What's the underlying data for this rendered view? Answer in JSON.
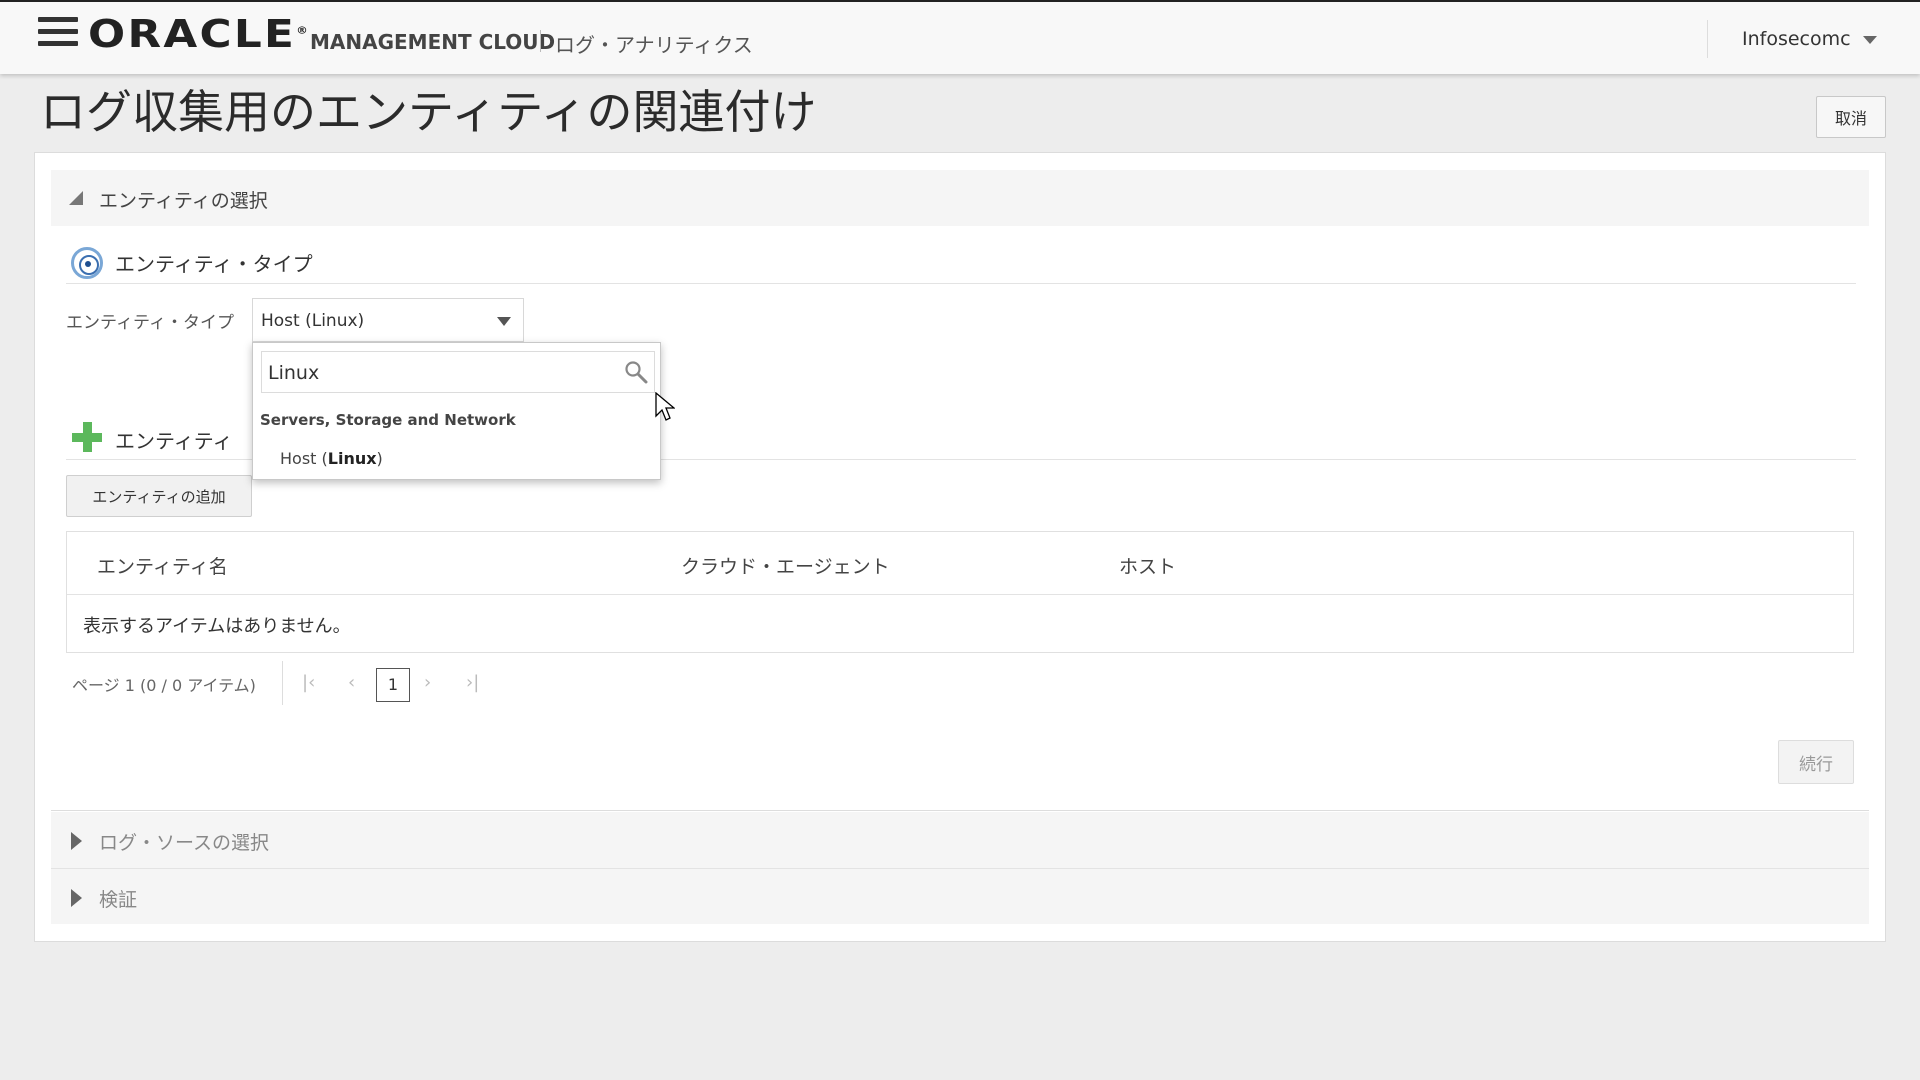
{
  "header": {
    "logo_text": "ORACLE",
    "product": "MANAGEMENT CLOUD",
    "subproduct": "ログ・アナリティクス",
    "user": "Infosecomc"
  },
  "page": {
    "title": "ログ収集用のエンティティの関連付け",
    "cancel_label": "取消"
  },
  "sections": {
    "entity_select": "エンティティの選択",
    "log_source": "ログ・ソースの選択",
    "validate": "検証"
  },
  "entity_type": {
    "heading": "エンティティ・タイプ",
    "field_label": "エンティティ・タイプ",
    "selected": "Host (Linux)"
  },
  "dropdown": {
    "search_value": "Linux",
    "group_label": "Servers, Storage and Network",
    "option_prefix": "Host (",
    "option_match": "Linux",
    "option_suffix": ")"
  },
  "entities": {
    "heading": "エンティティ",
    "add_button": "エンティティの追加",
    "columns": [
      "エンティティ名",
      "クラウド・エージェント",
      "ホスト"
    ],
    "empty_message": "表示するアイテムはありません。"
  },
  "pagination": {
    "info": "ページ  1  (0 / 0 アイテム)",
    "current_page": "1"
  },
  "footer": {
    "next_button": "続行"
  },
  "colors": {
    "accent_green": "#5cb85c",
    "target_blue": "#3b6fb0"
  }
}
